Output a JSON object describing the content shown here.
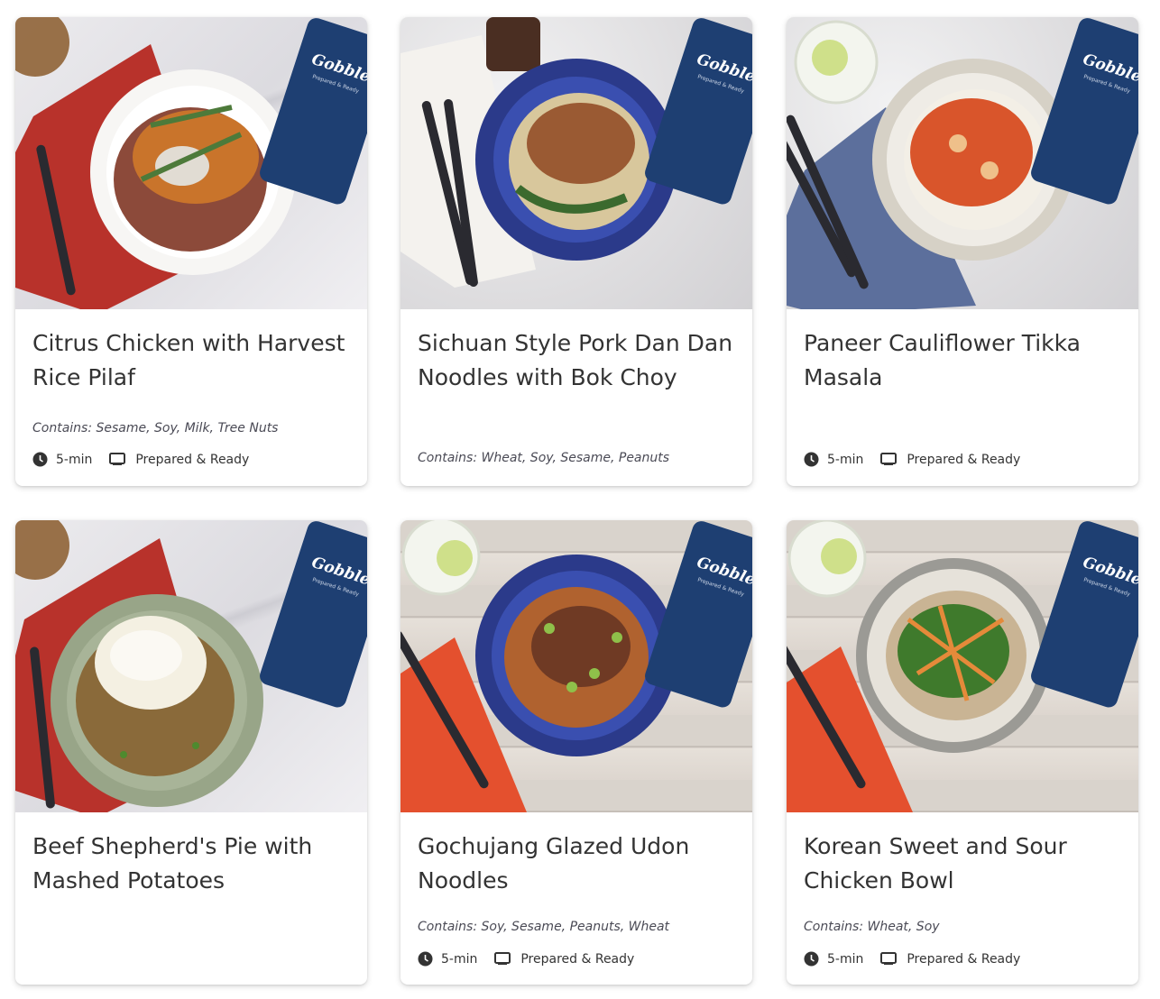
{
  "colors": {
    "card_bg": "#ffffff",
    "title_text": "#333333",
    "allergen_text": "#4a4a55",
    "gobble_box_blue": "#1e3f72"
  },
  "brand": {
    "box_logo": "Gobble",
    "box_tagline": "Prepared & Ready"
  },
  "meals": [
    {
      "title": "Citrus Chicken with Harvest Rice Pilaf",
      "contains": "Contains: Sesame, Soy, Milk, Tree Nuts",
      "time": "5-min",
      "type": "Prepared & Ready",
      "icons": [
        "clock-icon",
        "meal-box-icon"
      ]
    },
    {
      "title": "Sichuan Style Pork Dan Dan Noodles with Bok Choy",
      "contains": "Contains: Wheat, Soy, Sesame, Peanuts"
    },
    {
      "title": "Paneer Cauliflower Tikka Masala",
      "time": "5-min",
      "type": "Prepared & Ready"
    },
    {
      "title": "Beef Shepherd's Pie with Mashed Potatoes"
    },
    {
      "title": "Gochujang Glazed Udon Noodles",
      "contains": "Contains: Soy, Sesame, Peanuts, Wheat",
      "time": "5-min",
      "type": "Prepared & Ready"
    },
    {
      "title": "Korean Sweet and Sour Chicken Bowl",
      "contains": "Contains: Wheat, Soy",
      "time": "5-min",
      "type": "Prepared & Ready"
    }
  ]
}
